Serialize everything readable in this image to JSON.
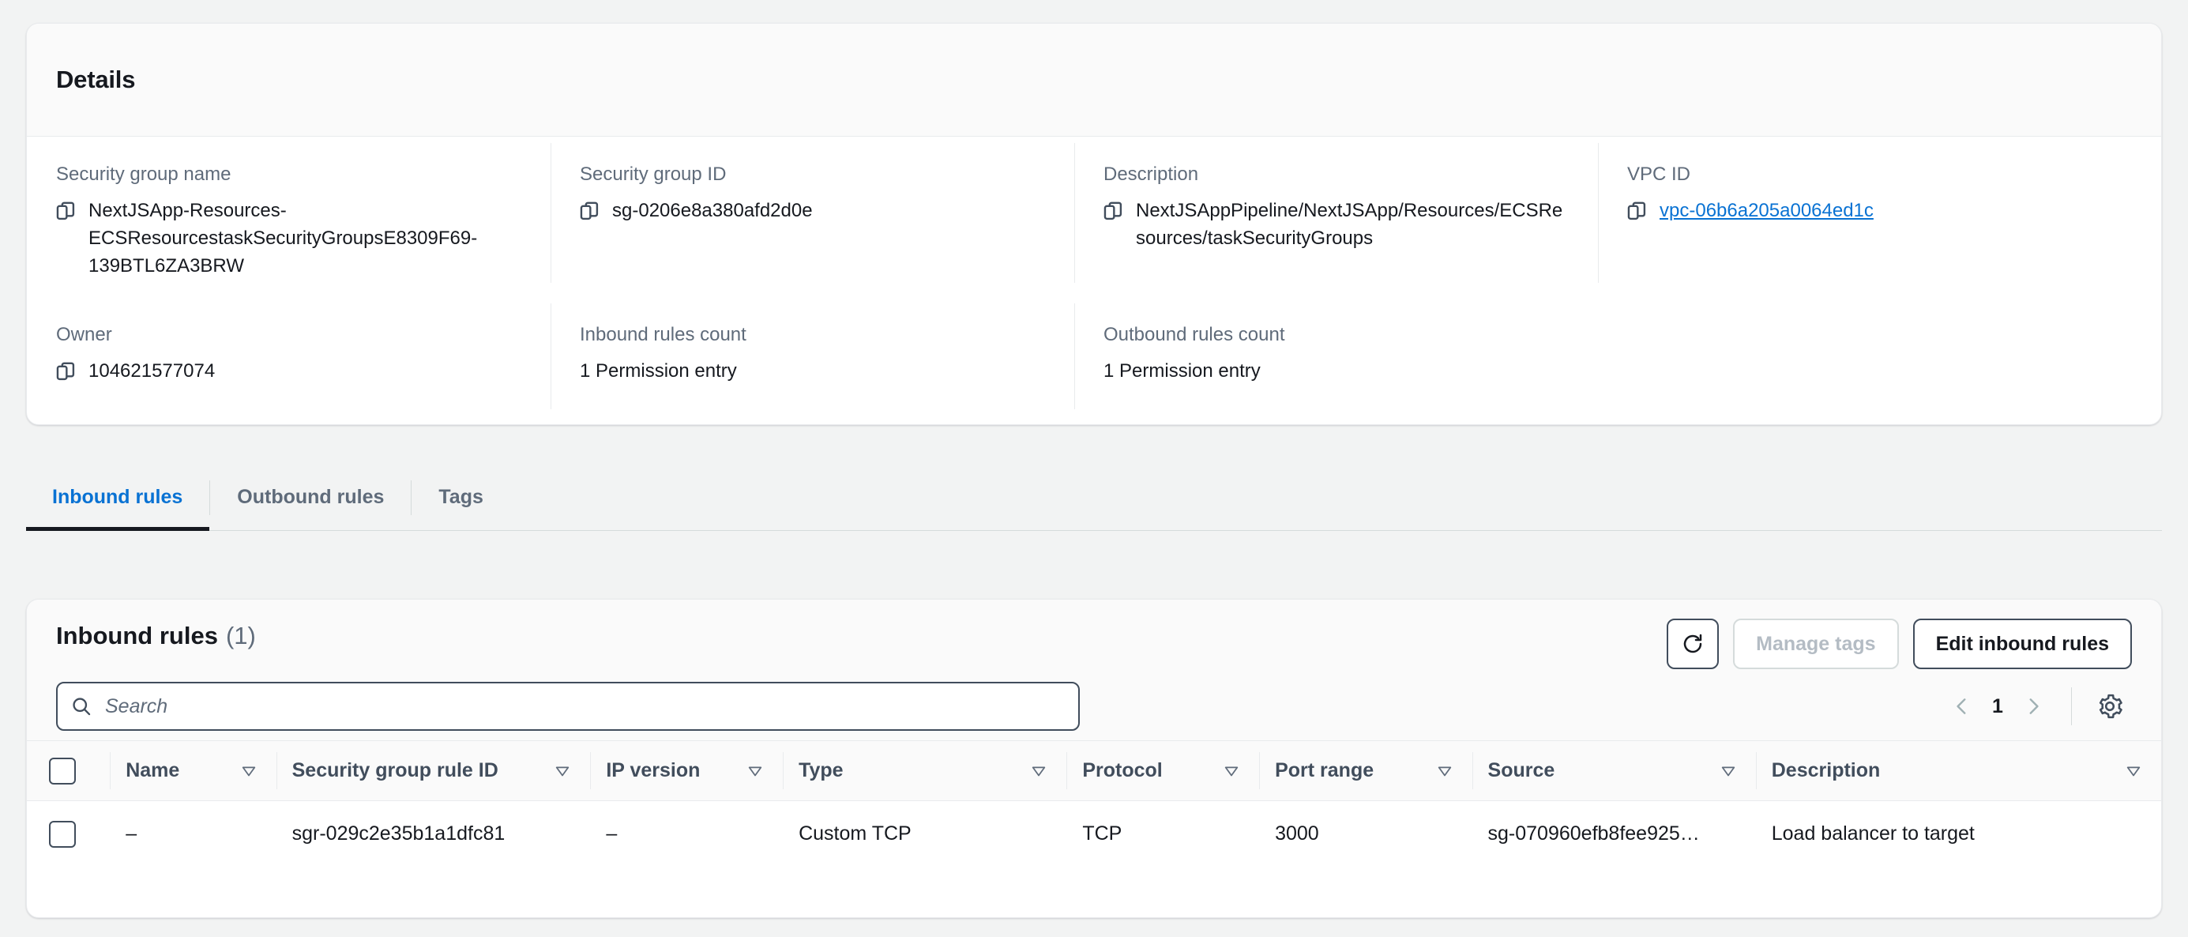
{
  "details": {
    "title": "Details",
    "fields": [
      {
        "label": "Security group name",
        "value": "NextJSApp-Resources-ECSResourcestaskSecurityGroupsE8309F69-139BTL6ZA3BRW",
        "icon": "copy-icon",
        "link": false
      },
      {
        "label": "Security group ID",
        "value": "sg-0206e8a380afd2d0e",
        "icon": "copy-icon",
        "link": false
      },
      {
        "label": "Description",
        "value": "NextJSAppPipeline/NextJSApp/Resources/ECSResources/taskSecurityGroups",
        "icon": "copy-icon",
        "link": false
      },
      {
        "label": "VPC ID",
        "value": "vpc-06b6a205a0064ed1c",
        "icon": "copy-icon",
        "link": true
      },
      {
        "label": "Owner",
        "value": "104621577074",
        "icon": "copy-icon",
        "link": false
      },
      {
        "label": "Inbound rules count",
        "value": "1 Permission entry",
        "icon": null,
        "link": false
      },
      {
        "label": "Outbound rules count",
        "value": "1 Permission entry",
        "icon": null,
        "link": false
      }
    ]
  },
  "tabs": [
    {
      "label": "Inbound rules",
      "active": true
    },
    {
      "label": "Outbound rules",
      "active": false
    },
    {
      "label": "Tags",
      "active": false
    }
  ],
  "rules_panel": {
    "title": "Inbound rules",
    "count": "(1)",
    "refresh_icon": "refresh-icon",
    "manage_tags_label": "Manage tags",
    "manage_tags_disabled": true,
    "edit_label": "Edit inbound rules",
    "search": {
      "placeholder": "Search",
      "value": "",
      "icon": "search-icon"
    },
    "pagination": {
      "prev_icon": "chevron-left-icon",
      "page": "1",
      "next_icon": "chevron-right-icon",
      "settings_icon": "gear-icon"
    },
    "table": {
      "columns": [
        "Name",
        "Security group rule ID",
        "IP version",
        "Type",
        "Protocol",
        "Port range",
        "Source",
        "Description"
      ],
      "rows": [
        {
          "name": "–",
          "rule_id": "sgr-029c2e35b1a1dfc81",
          "ip_version": "–",
          "type": "Custom TCP",
          "protocol": "TCP",
          "port_range": "3000",
          "source": "sg-070960efb8fee925…",
          "description": "Load balancer to target"
        }
      ]
    }
  },
  "colors": {
    "page_bg": "#f2f3f3",
    "panel_bg": "#ffffff",
    "head_bg": "#fafafa",
    "link": "#0972d3",
    "active_tab": "#0972d3",
    "label": "#5f6b7a",
    "text": "#16191f",
    "border": "#e9ebed",
    "control_border": "#414d5c",
    "disabled": "#b4bcc4"
  }
}
